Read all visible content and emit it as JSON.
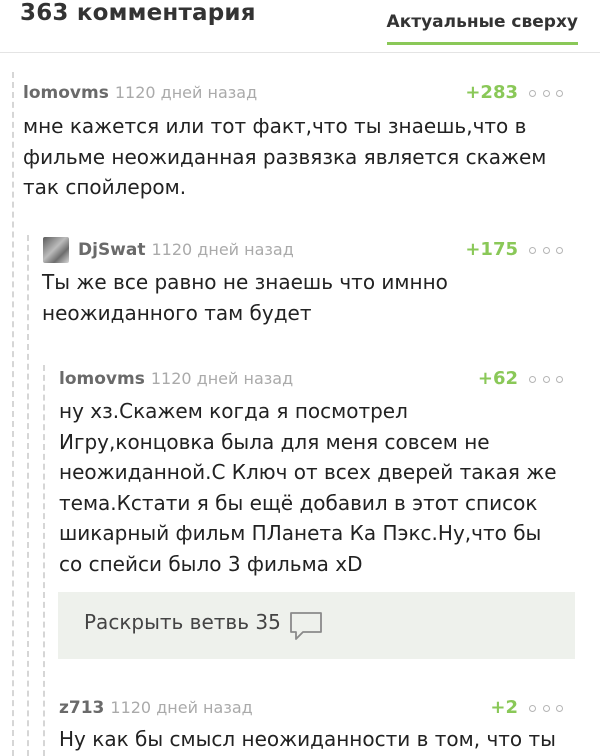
{
  "header": {
    "title": "363 комментария",
    "sort_label": "Актуальные сверху"
  },
  "comments": [
    {
      "author": "lomovms",
      "time": "1120 дней назад",
      "rating": "+283",
      "lines": [
        "мне кажется или тот факт,что ты знаешь,что в",
        "фильме неожиданная развязка является скажем",
        "так спойлером."
      ]
    },
    {
      "author": "DjSwat",
      "time": "1120 дней назад",
      "rating": "+175",
      "lines": [
        "Ты же все равно не знаешь что имнно",
        "неожиданного там будет"
      ]
    },
    {
      "author": "lomovms",
      "time": "1120 дней назад",
      "rating": "+62",
      "lines": [
        "ну хз.Скажем когда я посмотрел",
        "Игру,концовка была для меня совсем не",
        "неожиданной.С Ключ от всех дверей такая же",
        "тема.Кстати я бы ещё добавил в этот список",
        "шикарный фильм ПЛанета Ка Пэкс.Ну,что бы",
        "со спейси было 3 фильма xD"
      ]
    },
    {
      "author": "z713",
      "time": "1120 дней назад",
      "rating": "+2",
      "lines": [
        "Ну как бы смысл неожиданности в том, что ты"
      ]
    }
  ],
  "expand_branch": {
    "label": "Раскрыть ветвь 35"
  },
  "icons": {
    "more": "more-options-icon",
    "avatar": "avatar",
    "comment_bubble": "comment-bubble-icon"
  },
  "colors": {
    "accent": "#8ac858",
    "guide": "#d6d6d6",
    "expand_bg": "#eef1ec"
  }
}
